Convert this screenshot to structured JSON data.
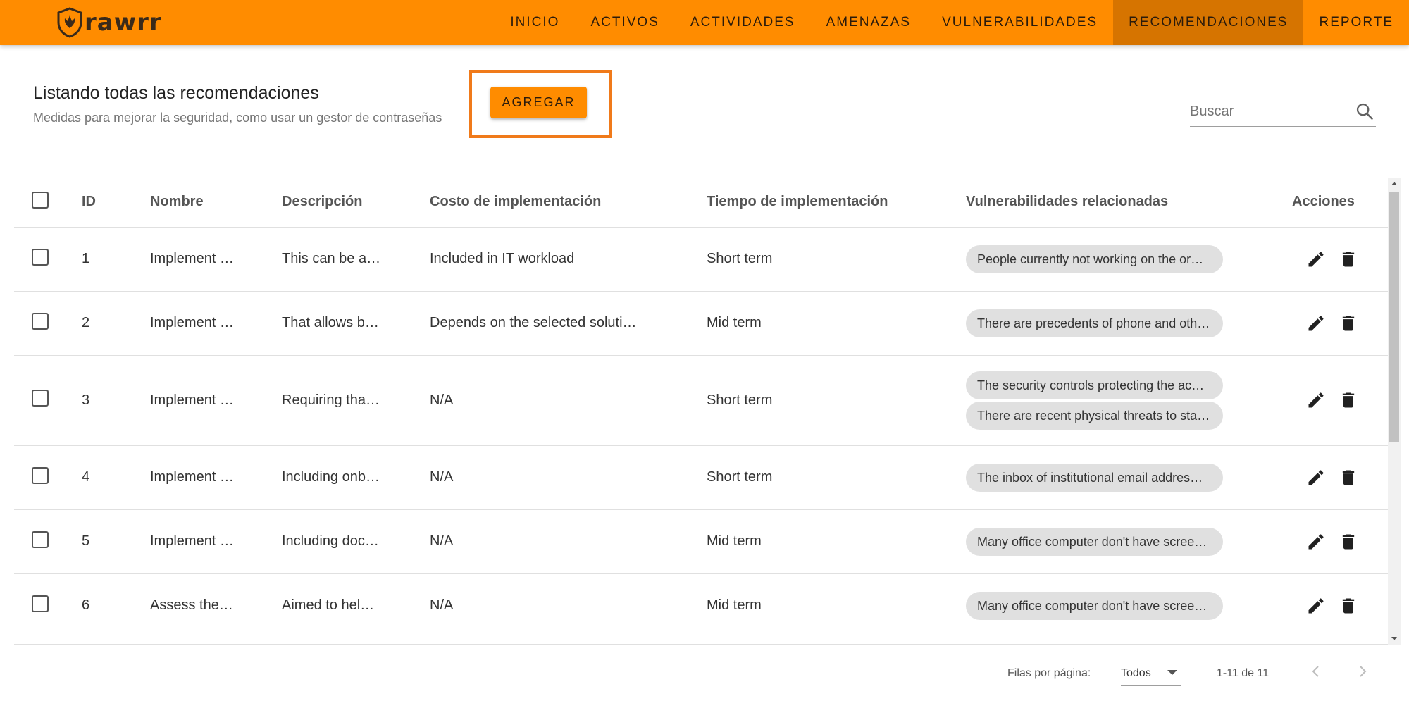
{
  "app": {
    "brand": "rawrr"
  },
  "nav": {
    "items": [
      {
        "label": "INICIO"
      },
      {
        "label": "ACTIVOS"
      },
      {
        "label": "ACTIVIDADES"
      },
      {
        "label": "AMENAZAS"
      },
      {
        "label": "VULNERABILIDADES"
      },
      {
        "label": "RECOMENDACIONES",
        "active": true
      },
      {
        "label": "REPORTE"
      }
    ],
    "accent_color": "#ff8c00",
    "active_color": "#d67400"
  },
  "header": {
    "title": "Listando todas las recomendaciones",
    "subtitle": "Medidas para mejorar la seguridad, como usar un gestor de contraseñas",
    "add_label": "AGREGAR"
  },
  "search": {
    "placeholder": "Buscar",
    "icon": "search-icon"
  },
  "table": {
    "columns": [
      "ID",
      "Nombre",
      "Descripción",
      "Costo de implementación",
      "Tiempo de implementación",
      "Vulnerabilidades relacionadas",
      "Acciones"
    ],
    "rows": [
      {
        "id": "1",
        "nombre": "Implement …",
        "descripcion": "This can be a…",
        "costo": "Included in IT workload",
        "tiempo": "Short term",
        "vulnerabilidades": [
          "People currently not working on the or…"
        ]
      },
      {
        "id": "2",
        "nombre": "Implement …",
        "descripcion": "That allows b…",
        "costo": "Depends on the selected soluti…",
        "tiempo": "Mid term",
        "vulnerabilidades": [
          "There are precedents of phone and oth…"
        ]
      },
      {
        "id": "3",
        "nombre": "Implement …",
        "descripcion": "Requiring tha…",
        "costo": "N/A",
        "tiempo": "Short term",
        "vulnerabilidades": [
          "The security controls protecting the ac…",
          "There are recent physical threats to sta…"
        ]
      },
      {
        "id": "4",
        "nombre": "Implement …",
        "descripcion": "Including onb…",
        "costo": "N/A",
        "tiempo": "Short term",
        "vulnerabilidades": [
          "The inbox of institutional email addres…"
        ]
      },
      {
        "id": "5",
        "nombre": "Implement …",
        "descripcion": "Including doc…",
        "costo": "N/A",
        "tiempo": "Mid term",
        "vulnerabilidades": [
          "Many office computer don't have scree…"
        ]
      },
      {
        "id": "6",
        "nombre": "Assess the…",
        "descripcion": "Aimed to hel…",
        "costo": "N/A",
        "tiempo": "Mid term",
        "vulnerabilidades": [
          "Many office computer don't have scree…"
        ]
      }
    ],
    "action_icons": [
      "edit-icon",
      "delete-icon"
    ]
  },
  "footer": {
    "rows_per_page_label": "Filas por página:",
    "rows_per_page_value": "Todos",
    "page_info": "1-11 de 11"
  }
}
